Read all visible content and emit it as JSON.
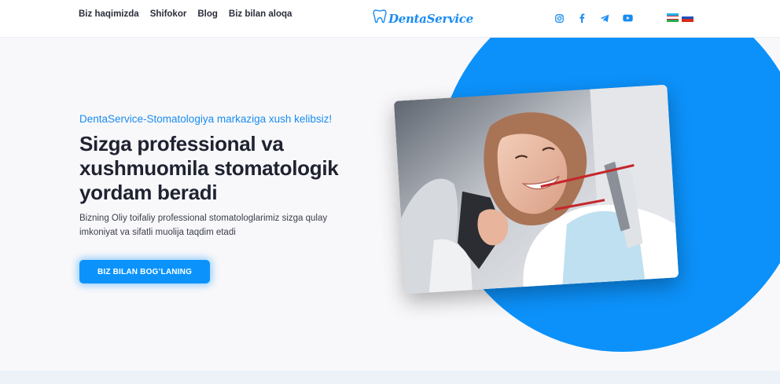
{
  "header": {
    "nav": [
      {
        "label": "Biz haqimizda"
      },
      {
        "label": "Shifokor"
      },
      {
        "label": "Blog"
      },
      {
        "label": "Biz bilan aloqa"
      }
    ],
    "logo_text": "DentaService",
    "socials": [
      "instagram-icon",
      "facebook-icon",
      "telegram-icon",
      "youtube-icon"
    ],
    "languages": [
      "uz",
      "ru"
    ],
    "accent_color": "#1a8cf0"
  },
  "hero": {
    "kicker": "DentaService-Stomatologiya markaziga xush kelibsiz!",
    "headline": "Sizga professional va xushmuomila stomatologik yordam beradi",
    "lead": "Bizning Oliy toifaliy professional stomatologlarimiz sizga qulay imkoniyat va sifatli muolija taqdim etadi",
    "cta_label": "BIZ BILAN BOG’LANING",
    "cta_color": "#0b93fb",
    "blob_color": "#0c91fa"
  }
}
